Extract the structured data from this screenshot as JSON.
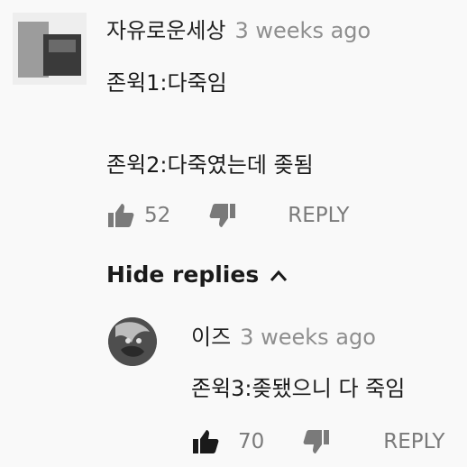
{
  "comment": {
    "author": "자유로운세상",
    "time": "3 weeks ago",
    "line1": "존윅1:다죽임",
    "line2": "존윅2:다죽였는데 좆됨",
    "likes": "52",
    "reply_label": "REPLY"
  },
  "hide_replies_label": "Hide replies",
  "reply": {
    "author": "이즈",
    "time": "3 weeks ago",
    "text": "존윅3:좆됐으니 다 죽임",
    "likes": "70",
    "reply_label": "REPLY"
  }
}
